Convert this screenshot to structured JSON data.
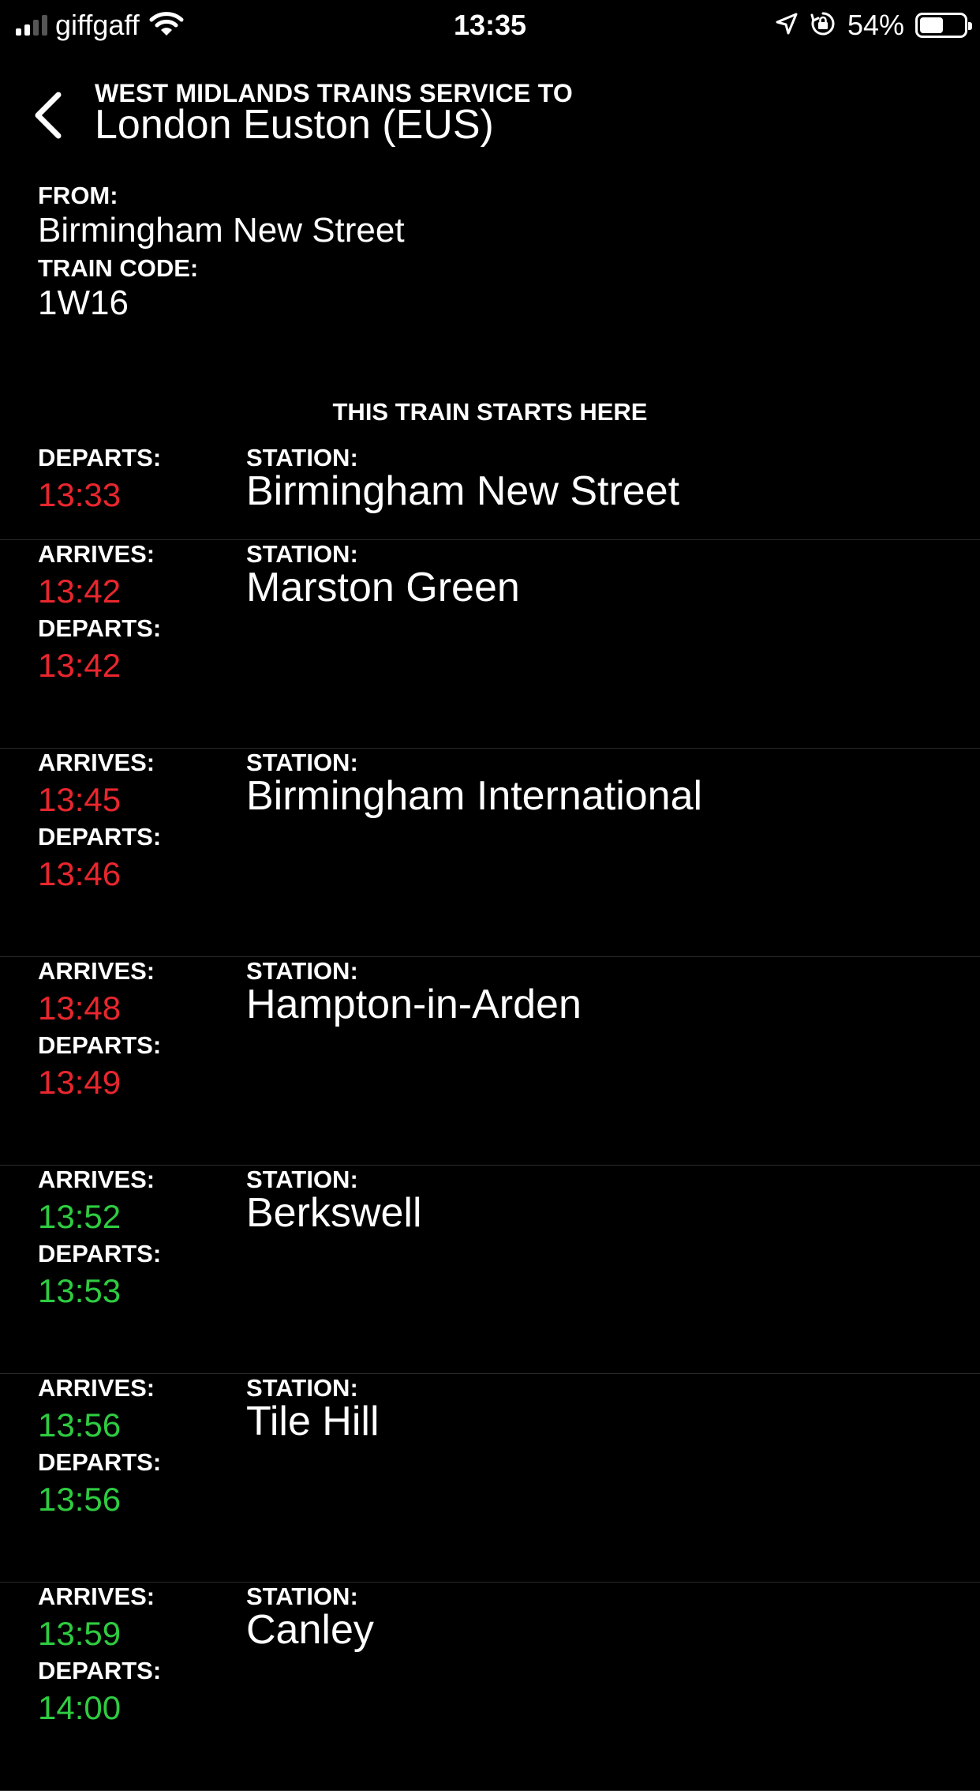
{
  "status_bar": {
    "carrier": "giffgaff",
    "time": "13:35",
    "battery_percent_text": "54%",
    "battery_level": 0.54,
    "signal_bars": 4,
    "signal_bars_active": 2
  },
  "header": {
    "kicker": "WEST MIDLANDS TRAINS SERVICE TO",
    "title": "London Euston (EUS)"
  },
  "info": {
    "from_label": "FROM:",
    "from_value": "Birmingham New Street",
    "train_code_label": "TRAIN CODE:",
    "train_code_value": "1W16"
  },
  "notice": "THIS TRAIN STARTS HERE",
  "labels": {
    "arrives": "ARRIVES:",
    "departs": "DEPARTS:",
    "station": "STATION:"
  },
  "colors": {
    "late": "#e8262d",
    "on_time": "#2ecc40",
    "background": "#000000",
    "text": "#ffffff"
  },
  "stops": [
    {
      "station": "Birmingham New Street",
      "arrives": null,
      "departs": "13:33",
      "status": "late"
    },
    {
      "station": "Marston Green",
      "arrives": "13:42",
      "departs": "13:42",
      "status": "late"
    },
    {
      "station": "Birmingham International",
      "arrives": "13:45",
      "departs": "13:46",
      "status": "late"
    },
    {
      "station": "Hampton-in-Arden",
      "arrives": "13:48",
      "departs": "13:49",
      "status": "late"
    },
    {
      "station": "Berkswell",
      "arrives": "13:52",
      "departs": "13:53",
      "status": "on_time"
    },
    {
      "station": "Tile Hill",
      "arrives": "13:56",
      "departs": "13:56",
      "status": "on_time"
    },
    {
      "station": "Canley",
      "arrives": "13:59",
      "departs": "14:00",
      "status": "on_time"
    }
  ]
}
